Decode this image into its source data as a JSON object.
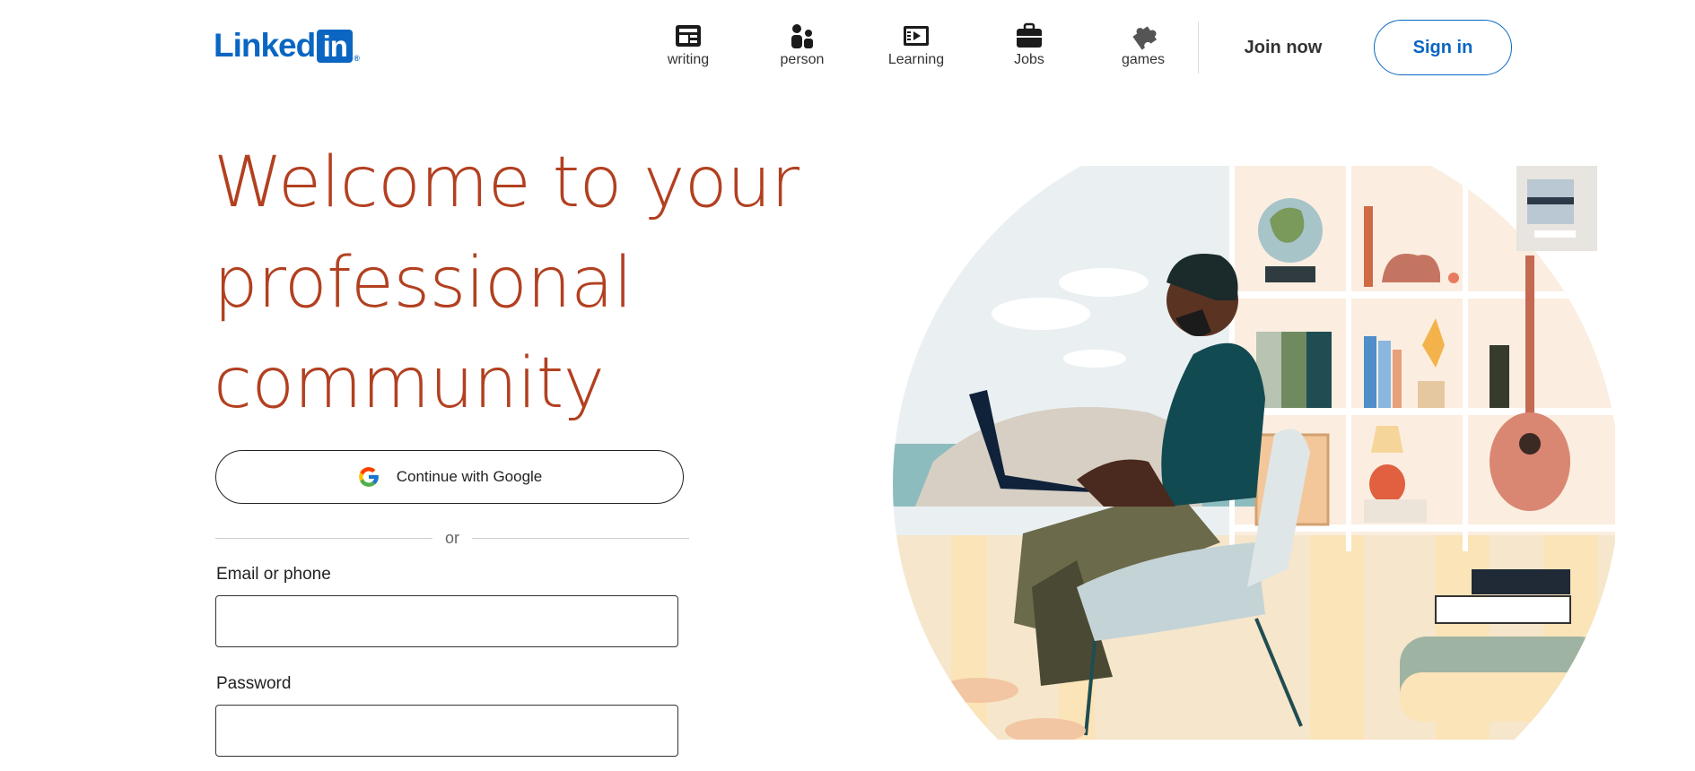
{
  "header": {
    "logo_text": "Linked",
    "logo_box_text": "in",
    "logo_reg": "®",
    "nav": [
      {
        "label": "writing",
        "icon": "article-icon"
      },
      {
        "label": "person",
        "icon": "people-icon"
      },
      {
        "label": "Learning",
        "icon": "video-icon"
      },
      {
        "label": "Jobs",
        "icon": "briefcase-icon"
      },
      {
        "label": "games",
        "icon": "puzzle-icon"
      }
    ],
    "join_label": "Join now",
    "signin_label": "Sign in"
  },
  "hero": {
    "title_line1": "Welcome to your",
    "title_line2": "professional",
    "title_line3": "community"
  },
  "form": {
    "google_label": "Continue with Google",
    "or_text": "or",
    "email_label": "Email or phone",
    "email_value": "",
    "password_label": "Password",
    "password_value": ""
  },
  "colors": {
    "brand": "#0a66c2",
    "headline": "#b24020"
  }
}
